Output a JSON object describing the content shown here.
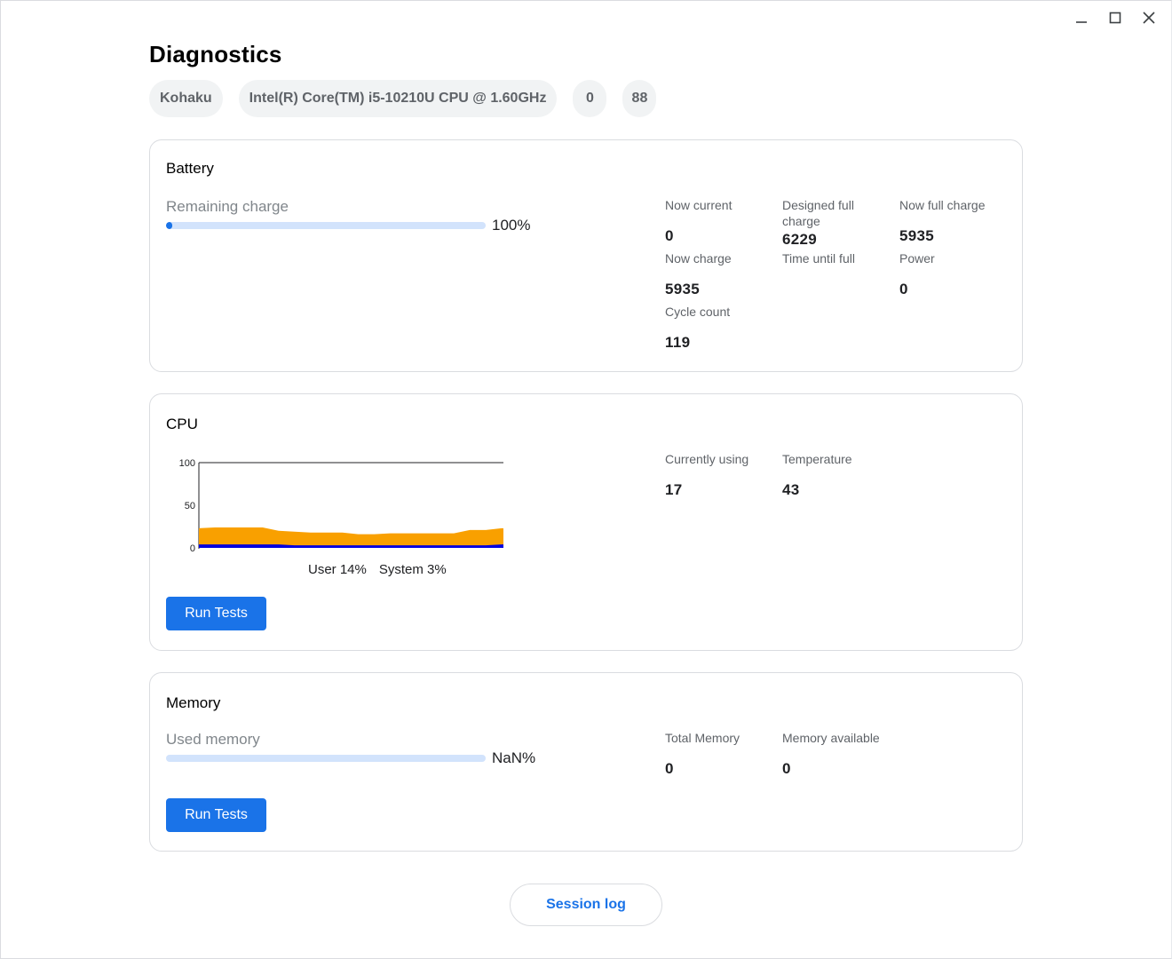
{
  "window_controls": {
    "minimize_icon": "minimize-icon",
    "maximize_icon": "maximize-icon",
    "close_icon": "close-icon"
  },
  "page": {
    "title": "Diagnostics"
  },
  "system_chips": [
    "Kohaku",
    "Intel(R) Core(TM) i5-10210U CPU @ 1.60GHz",
    "0",
    "88"
  ],
  "battery": {
    "title": "Battery",
    "remaining_label": "Remaining charge",
    "remaining_fraction": 0.02,
    "remaining_pct": "100%",
    "stats": {
      "now_current": {
        "label": "Now current",
        "value": "0"
      },
      "designed_full_charge": {
        "label": "Designed full charge",
        "value": "6229"
      },
      "now_full_charge": {
        "label": "Now full charge",
        "value": "5935"
      },
      "now_charge": {
        "label": "Now charge",
        "value": "5935"
      },
      "time_until_full": {
        "label": "Time until full",
        "value": ""
      },
      "power": {
        "label": "Power",
        "value": "0"
      },
      "cycle_count": {
        "label": "Cycle count",
        "value": "119"
      }
    }
  },
  "cpu": {
    "title": "CPU",
    "legend_user": "User 14%",
    "legend_system": "System 3%",
    "run_tests": "Run Tests",
    "stats": {
      "currently_using": {
        "label": "Currently using",
        "value": "17"
      },
      "temperature": {
        "label": "Temperature",
        "value": "43"
      }
    },
    "colors": {
      "user": "#f9a000",
      "system": "#0000e0"
    }
  },
  "memory": {
    "title": "Memory",
    "used_label": "Used memory",
    "used_fraction": 0,
    "used_pct": "NaN%",
    "run_tests": "Run Tests",
    "stats": {
      "total": {
        "label": "Total Memory",
        "value": "0"
      },
      "available": {
        "label": "Memory available",
        "value": "0"
      }
    }
  },
  "footer": {
    "session_log": "Session log"
  },
  "chart_data": {
    "type": "area",
    "ylim": [
      0,
      100
    ],
    "y_ticks": [
      "100",
      "50",
      "0"
    ],
    "x": [
      0,
      1,
      2,
      3,
      4,
      5,
      6,
      7,
      8,
      9,
      10,
      11,
      12,
      13,
      14,
      15,
      16,
      17,
      18,
      19,
      20
    ],
    "series": [
      {
        "name": "User",
        "values": [
          19,
          20,
          20,
          20,
          20,
          16,
          16,
          15,
          15,
          15,
          13,
          13,
          14,
          14,
          14,
          14,
          14,
          18,
          18,
          19,
          18
        ]
      },
      {
        "name": "System",
        "values": [
          4,
          4,
          4,
          4,
          4,
          4,
          3,
          3,
          3,
          3,
          3,
          3,
          3,
          3,
          3,
          3,
          3,
          3,
          3,
          4,
          4
        ]
      }
    ]
  }
}
